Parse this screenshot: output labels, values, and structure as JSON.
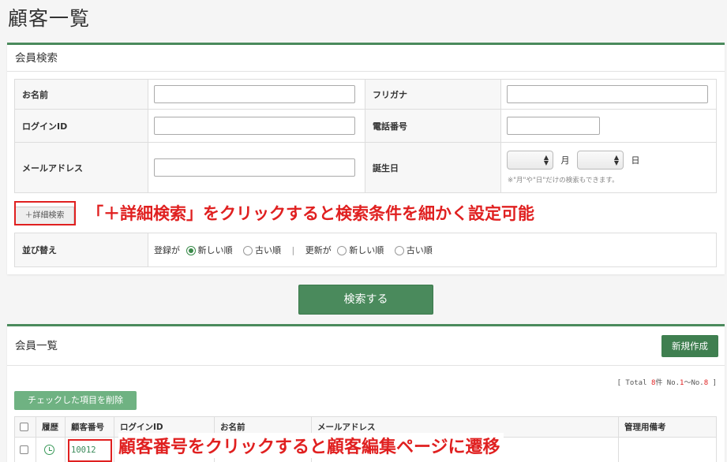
{
  "page": {
    "title": "顧客一覧"
  },
  "search": {
    "header": "会員検索",
    "fields": {
      "name_label": "お名前",
      "furigana_label": "フリガナ",
      "login_id_label": "ログインID",
      "phone_label": "電話番号",
      "email_label": "メールアドレス",
      "birthday_label": "誕生日",
      "month_label": "月",
      "day_label": "日",
      "birthday_note": "※\"月\"や\"日\"だけの検索もできます。"
    },
    "advanced_label": "＋詳細検索",
    "sort": {
      "label": "並び替え",
      "registered_label": "登録が",
      "updated_label": "更新が",
      "newest": "新しい順",
      "oldest": "古い順",
      "divider": "|"
    },
    "submit_label": "検索する"
  },
  "annotations": {
    "advanced": "「＋詳細検索」をクリックすると検索条件を細かく設定可能",
    "customer_number": "顧客番号をクリックすると顧客編集ページに遷移"
  },
  "list": {
    "header": "会員一覧",
    "new_label": "新規作成",
    "total": {
      "prefix": "[ Total ",
      "count": "8",
      "mid": "件 No.",
      "from": "1",
      "tilde": "〜No.",
      "to": "8",
      "suffix": " ]"
    },
    "delete_label": "チェックした項目を削除",
    "columns": [
      "",
      "履歴",
      "顧客番号",
      "ログインID",
      "お名前",
      "メールアドレス",
      "管理用備考"
    ],
    "rows": [
      {
        "customer_number": "10012"
      }
    ]
  },
  "colors": {
    "accent": "#4a8a5c",
    "annotation": "#e02020"
  }
}
